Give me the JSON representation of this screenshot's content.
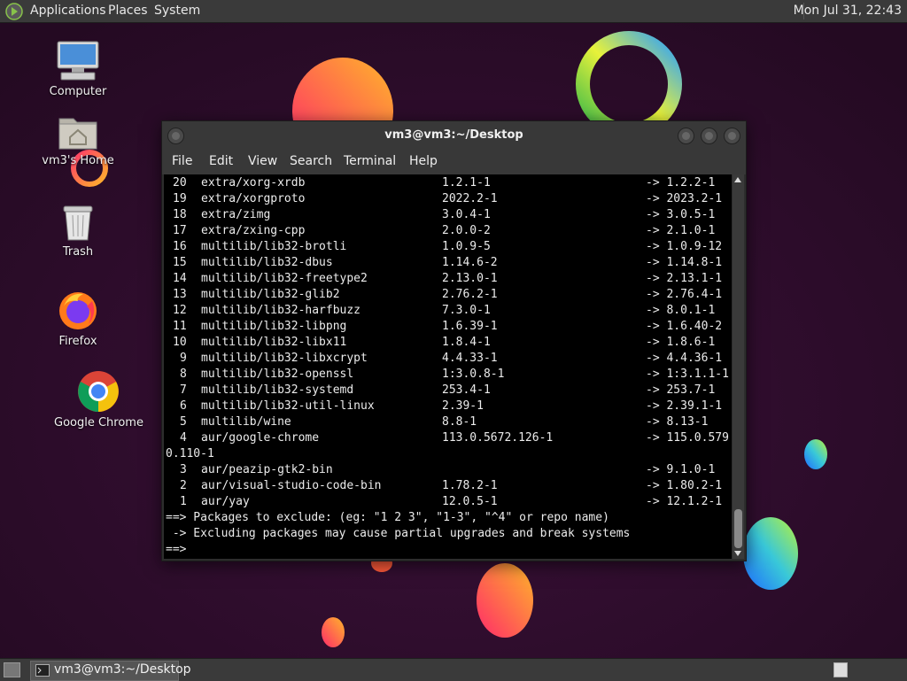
{
  "top_panel": {
    "menus": [
      "Applications",
      "Places",
      "System"
    ],
    "clock": "Mon Jul 31, 22:43"
  },
  "desktop_icons": [
    {
      "label": "Computer",
      "icon": "computer-icon"
    },
    {
      "label": "vm3's Home",
      "icon": "home-folder-icon"
    },
    {
      "label": "Trash",
      "icon": "trash-icon"
    },
    {
      "label": "Firefox",
      "icon": "firefox-icon"
    },
    {
      "label": "Google Chrome",
      "icon": "chrome-icon"
    }
  ],
  "terminal": {
    "title": "vm3@vm3:~/Desktop",
    "menus": [
      "File",
      "Edit",
      "View",
      "Search",
      "Terminal",
      "Help"
    ],
    "packages": [
      {
        "num": "20",
        "name": "extra/xorg-xrdb",
        "old": "1.2.1-1",
        "new": "-> 1.2.2-1"
      },
      {
        "num": "19",
        "name": "extra/xorgproto",
        "old": "2022.2-1",
        "new": "-> 2023.2-1"
      },
      {
        "num": "18",
        "name": "extra/zimg",
        "old": "3.0.4-1",
        "new": "-> 3.0.5-1"
      },
      {
        "num": "17",
        "name": "extra/zxing-cpp",
        "old": "2.0.0-2",
        "new": "-> 2.1.0-1"
      },
      {
        "num": "16",
        "name": "multilib/lib32-brotli",
        "old": "1.0.9-5",
        "new": "-> 1.0.9-12"
      },
      {
        "num": "15",
        "name": "multilib/lib32-dbus",
        "old": "1.14.6-2",
        "new": "-> 1.14.8-1"
      },
      {
        "num": "14",
        "name": "multilib/lib32-freetype2",
        "old": "2.13.0-1",
        "new": "-> 2.13.1-1"
      },
      {
        "num": "13",
        "name": "multilib/lib32-glib2",
        "old": "2.76.2-1",
        "new": "-> 2.76.4-1"
      },
      {
        "num": "12",
        "name": "multilib/lib32-harfbuzz",
        "old": "7.3.0-1",
        "new": "-> 8.0.1-1"
      },
      {
        "num": "11",
        "name": "multilib/lib32-libpng",
        "old": "1.6.39-1",
        "new": "-> 1.6.40-2"
      },
      {
        "num": "10",
        "name": "multilib/lib32-libx11",
        "old": "1.8.4-1",
        "new": "-> 1.8.6-1"
      },
      {
        "num": "9",
        "name": "multilib/lib32-libxcrypt",
        "old": "4.4.33-1",
        "new": "-> 4.4.36-1"
      },
      {
        "num": "8",
        "name": "multilib/lib32-openssl",
        "old": "1:3.0.8-1",
        "new": "-> 1:3.1.1-1"
      },
      {
        "num": "7",
        "name": "multilib/lib32-systemd",
        "old": "253.4-1",
        "new": "-> 253.7-1"
      },
      {
        "num": "6",
        "name": "multilib/lib32-util-linux",
        "old": "2.39-1",
        "new": "-> 2.39.1-1"
      },
      {
        "num": "5",
        "name": "multilib/wine",
        "old": "8.8-1",
        "new": "-> 8.13-1"
      },
      {
        "num": "4",
        "name": "aur/google-chrome",
        "old": "113.0.5672.126-1",
        "new": "-> 115.0.579"
      },
      {
        "num": "",
        "name": "",
        "old": "",
        "new": "",
        "wrap": "0.110-1"
      },
      {
        "num": "3",
        "name": "aur/peazip-gtk2-bin",
        "old": "",
        "new": "-> 9.1.0-1"
      },
      {
        "num": "2",
        "name": "aur/visual-studio-code-bin",
        "old": "1.78.2-1",
        "new": "-> 1.80.2-1"
      },
      {
        "num": "1",
        "name": "aur/yay",
        "old": "12.0.5-1",
        "new": "-> 12.1.2-1"
      }
    ],
    "prompt_lines": [
      "==> Packages to exclude: (eg: \"1 2 3\", \"1-3\", \"^4\" or repo name)",
      " -> Excluding packages may cause partial upgrades and break systems",
      "==>"
    ]
  },
  "bottom_panel": {
    "task_label": "vm3@vm3:~/Desktop"
  }
}
